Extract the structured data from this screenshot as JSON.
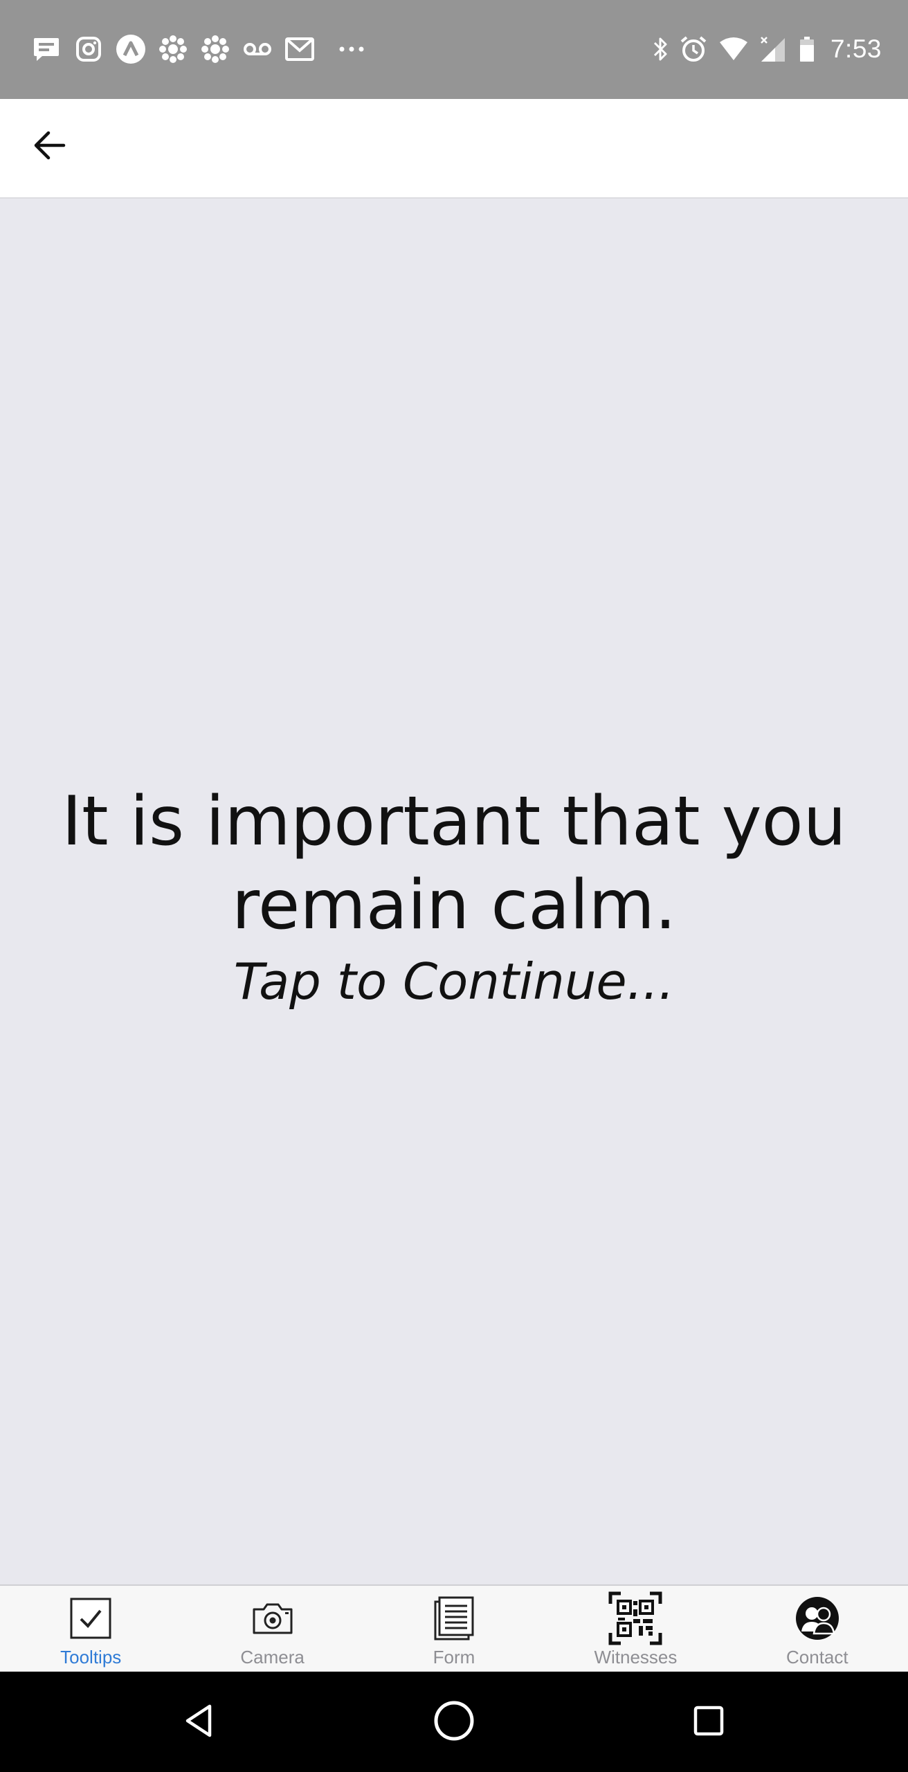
{
  "status_bar": {
    "time": "7:53",
    "left_icons": [
      "message-icon",
      "instagram-icon",
      "app-a-icon",
      "cbc-icon",
      "cbc-icon",
      "voicemail-icon",
      "gmail-icon",
      "more-dots-icon"
    ],
    "right_icons": [
      "bluetooth-icon",
      "alarm-icon",
      "wifi-icon",
      "cell-signal-icon",
      "battery-icon"
    ]
  },
  "app_bar": {
    "back_icon": "arrow-left-icon"
  },
  "main": {
    "message": "It is important that you remain calm.",
    "prompt": "Tap to Continue..."
  },
  "tab_bar": {
    "active_color": "#2f7bd6",
    "inactive_color": "#8e8e93",
    "tabs": [
      {
        "label": "Tooltips",
        "icon": "checkbox-icon",
        "active": true
      },
      {
        "label": "Camera",
        "icon": "camera-icon",
        "active": false
      },
      {
        "label": "Form",
        "icon": "document-icon",
        "active": false
      },
      {
        "label": "Witnesses",
        "icon": "qr-code-icon",
        "active": false
      },
      {
        "label": "Contact",
        "icon": "contacts-icon",
        "active": false
      }
    ]
  },
  "nav_bar": {
    "buttons": [
      "back-triangle-icon",
      "home-circle-icon",
      "recents-square-icon"
    ]
  }
}
